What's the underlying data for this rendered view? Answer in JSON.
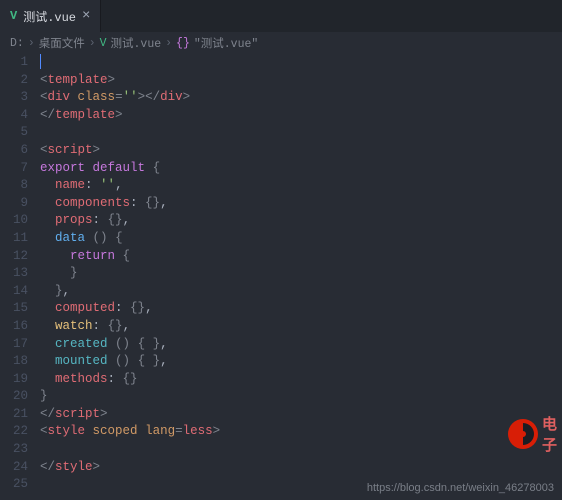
{
  "tab": {
    "filename": "测试.vue",
    "close": "×"
  },
  "breadcrumb": {
    "seg0": "D:",
    "seg1": "桌面文件",
    "seg2": "测试.vue",
    "seg3": "{}",
    "seg4": "\"测试.vue\"",
    "sep": "›"
  },
  "icons": {
    "vue": "V"
  },
  "code_lines": [
    [],
    [
      {
        "c": "t-gray",
        "t": "<"
      },
      {
        "c": "t-red",
        "t": "template"
      },
      {
        "c": "t-gray",
        "t": ">"
      }
    ],
    [
      {
        "c": "t-gray",
        "t": "<"
      },
      {
        "c": "t-red",
        "t": "div"
      },
      {
        "c": "t-white",
        "t": " "
      },
      {
        "c": "t-orange",
        "t": "class"
      },
      {
        "c": "t-gray",
        "t": "="
      },
      {
        "c": "t-green",
        "t": "''"
      },
      {
        "c": "t-gray",
        "t": "></"
      },
      {
        "c": "t-red",
        "t": "div"
      },
      {
        "c": "t-gray",
        "t": ">"
      }
    ],
    [
      {
        "c": "t-gray",
        "t": "</"
      },
      {
        "c": "t-red",
        "t": "template"
      },
      {
        "c": "t-gray",
        "t": ">"
      }
    ],
    [],
    [
      {
        "c": "t-gray",
        "t": "<"
      },
      {
        "c": "t-red",
        "t": "script"
      },
      {
        "c": "t-gray",
        "t": ">"
      }
    ],
    [
      {
        "c": "t-purple",
        "t": "export"
      },
      {
        "c": "t-white",
        "t": " "
      },
      {
        "c": "t-purple",
        "t": "default"
      },
      {
        "c": "t-white",
        "t": " "
      },
      {
        "c": "t-gray",
        "t": "{"
      }
    ],
    [
      {
        "c": "",
        "t": "  "
      },
      {
        "c": "t-red",
        "t": "name"
      },
      {
        "c": "t-white",
        "t": ": "
      },
      {
        "c": "t-green",
        "t": "''"
      },
      {
        "c": "t-white",
        "t": ","
      }
    ],
    [
      {
        "c": "",
        "t": "  "
      },
      {
        "c": "t-red",
        "t": "components"
      },
      {
        "c": "t-white",
        "t": ": "
      },
      {
        "c": "t-gray",
        "t": "{}"
      },
      {
        "c": "t-white",
        "t": ","
      }
    ],
    [
      {
        "c": "",
        "t": "  "
      },
      {
        "c": "t-red",
        "t": "props"
      },
      {
        "c": "t-white",
        "t": ": "
      },
      {
        "c": "t-gray",
        "t": "{}"
      },
      {
        "c": "t-white",
        "t": ","
      }
    ],
    [
      {
        "c": "",
        "t": "  "
      },
      {
        "c": "t-blue",
        "t": "data"
      },
      {
        "c": "t-white",
        "t": " "
      },
      {
        "c": "t-gray",
        "t": "()"
      },
      {
        "c": "t-white",
        "t": " "
      },
      {
        "c": "t-gray",
        "t": "{"
      }
    ],
    [
      {
        "c": "",
        "t": "    "
      },
      {
        "c": "t-purple",
        "t": "return"
      },
      {
        "c": "t-white",
        "t": " "
      },
      {
        "c": "t-gray",
        "t": "{"
      }
    ],
    [
      {
        "c": "",
        "t": "    "
      },
      {
        "c": "t-gray",
        "t": "}"
      }
    ],
    [
      {
        "c": "",
        "t": "  "
      },
      {
        "c": "t-gray",
        "t": "}"
      },
      {
        "c": "t-white",
        "t": ","
      }
    ],
    [
      {
        "c": "",
        "t": "  "
      },
      {
        "c": "t-red",
        "t": "computed"
      },
      {
        "c": "t-white",
        "t": ": "
      },
      {
        "c": "t-gray",
        "t": "{}"
      },
      {
        "c": "t-white",
        "t": ","
      }
    ],
    [
      {
        "c": "",
        "t": "  "
      },
      {
        "c": "t-yellow",
        "t": "watch"
      },
      {
        "c": "t-white",
        "t": ": "
      },
      {
        "c": "t-gray",
        "t": "{}"
      },
      {
        "c": "t-white",
        "t": ","
      }
    ],
    [
      {
        "c": "",
        "t": "  "
      },
      {
        "c": "t-cyan",
        "t": "created"
      },
      {
        "c": "t-white",
        "t": " "
      },
      {
        "c": "t-gray",
        "t": "()"
      },
      {
        "c": "t-white",
        "t": " "
      },
      {
        "c": "t-gray",
        "t": "{ }"
      },
      {
        "c": "t-white",
        "t": ","
      }
    ],
    [
      {
        "c": "",
        "t": "  "
      },
      {
        "c": "t-cyan",
        "t": "mounted"
      },
      {
        "c": "t-white",
        "t": " "
      },
      {
        "c": "t-gray",
        "t": "()"
      },
      {
        "c": "t-white",
        "t": " "
      },
      {
        "c": "t-gray",
        "t": "{ }"
      },
      {
        "c": "t-white",
        "t": ","
      }
    ],
    [
      {
        "c": "",
        "t": "  "
      },
      {
        "c": "t-red",
        "t": "methods"
      },
      {
        "c": "t-white",
        "t": ": "
      },
      {
        "c": "t-gray",
        "t": "{}"
      }
    ],
    [
      {
        "c": "t-gray",
        "t": "}"
      }
    ],
    [
      {
        "c": "t-gray",
        "t": "</"
      },
      {
        "c": "t-red",
        "t": "script"
      },
      {
        "c": "t-gray",
        "t": ">"
      }
    ],
    [
      {
        "c": "t-gray",
        "t": "<"
      },
      {
        "c": "t-red",
        "t": "style"
      },
      {
        "c": "t-white",
        "t": " "
      },
      {
        "c": "t-orange",
        "t": "scoped"
      },
      {
        "c": "t-white",
        "t": " "
      },
      {
        "c": "t-orange",
        "t": "lang"
      },
      {
        "c": "t-gray",
        "t": "="
      },
      {
        "c": "t-red",
        "t": "less"
      },
      {
        "c": "t-gray",
        "t": ">"
      }
    ],
    [],
    [
      {
        "c": "t-gray",
        "t": "</"
      },
      {
        "c": "t-red",
        "t": "style"
      },
      {
        "c": "t-gray",
        "t": ">"
      }
    ],
    []
  ],
  "watermark": "https://blog.csdn.net/weixin_46278003",
  "logo_text": "电子"
}
